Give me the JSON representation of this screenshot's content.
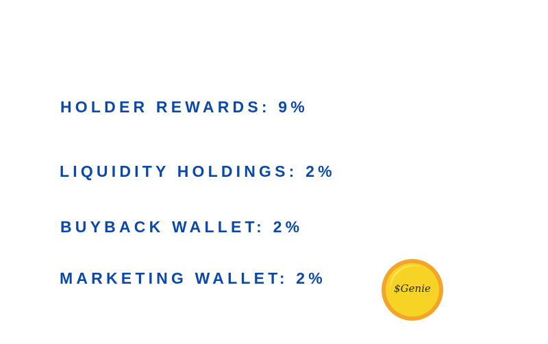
{
  "colors": {
    "text": "#0b49a8",
    "coin_fill": "#f6d325",
    "coin_rim": "#f2a52a",
    "coin_shine": "#fbe864",
    "coin_text": "#2f2a16"
  },
  "lines": [
    {
      "text": "HOLDER REWARDS: 9%"
    },
    {
      "text": "LIQUIDITY HOLDINGS: 2%"
    },
    {
      "text": "BUYBACK WALLET: 2%"
    },
    {
      "text": "MARKETING WALLET: 2%"
    }
  ],
  "coin": {
    "icon": "genie-coin-logo",
    "text": "$Genie"
  }
}
